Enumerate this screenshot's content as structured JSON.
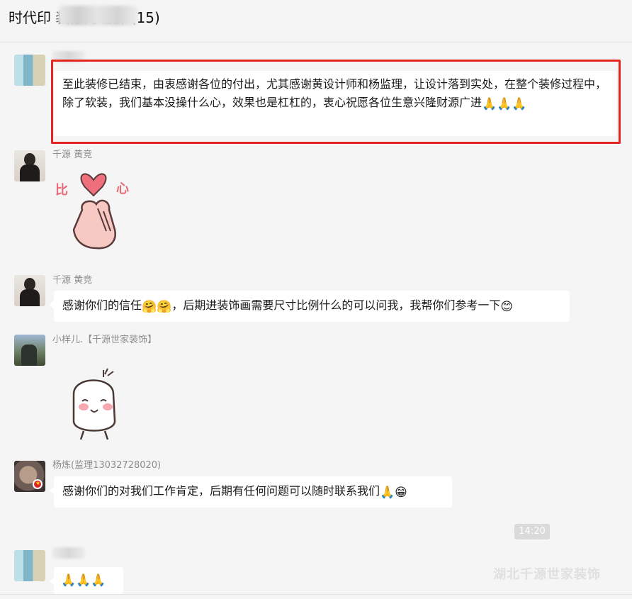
{
  "window": {
    "title": "时代印 装修沟通群 (15)"
  },
  "messages": [
    {
      "sender": "",
      "text": "至此装修已结束，由衷感谢各位的付出，尤其感谢黄设计师和杨监理，让设计落到实处，在整个装修过程中，除了软装，我们基本没操什么心，效果也是杠杠的，衷心祝愿各位生意兴隆财源广进",
      "emoji": "🙏🙏🙏"
    },
    {
      "sender": "千源 黄竞",
      "sticker_text_left": "比",
      "sticker_text_right": "心"
    },
    {
      "sender": "千源 黄竞",
      "text_a": "感谢你们的信任",
      "emoji_a": "🤗🤗",
      "text_b": "，后期进装饰画需要尺寸比例什么的可以问我，我帮你们参考一下",
      "emoji_b": "😊"
    },
    {
      "sender": "小样儿.【千源世家装饰】"
    },
    {
      "sender": "杨炼(监理13032728020)",
      "text": "感谢你们的对我们工作肯定，后期有任何问题可以随时联系我们",
      "emoji": "🙏😁"
    },
    {
      "sender": "",
      "emoji": "🙏🙏🙏"
    }
  ],
  "time_divider": "14:20",
  "watermark": "湖北千源世家装饰",
  "colors": {
    "background": "#f5f5f5",
    "bubble": "#ffffff",
    "highlight": "#e5251f"
  }
}
